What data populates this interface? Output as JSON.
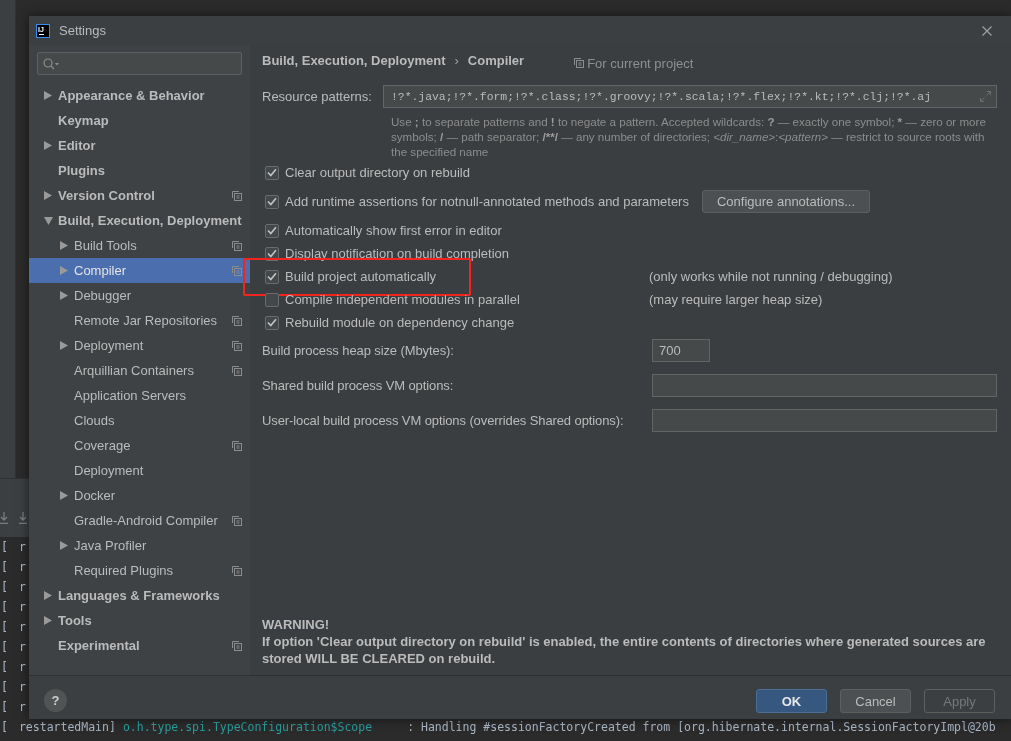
{
  "background": {
    "console": {
      "lines": [
        {
          "bracket": "[",
          "thread": "r"
        },
        {
          "bracket": "[",
          "thread": "r"
        },
        {
          "bracket": "[",
          "thread": "r"
        },
        {
          "bracket": "[",
          "thread": "r"
        },
        {
          "bracket": "[",
          "thread": "r"
        },
        {
          "bracket": "[",
          "thread": "r"
        },
        {
          "bracket": "[",
          "thread": "r"
        },
        {
          "bracket": "[",
          "thread": "r"
        },
        {
          "bracket": "[",
          "thread": "r"
        },
        {
          "bracket": "[",
          "thread": "restartedMain]",
          "logger": "o.h.type.spi.TypeConfiguration$Scope",
          "message": ": Handling #sessionFactoryCreated from [org.hibernate.internal.SessionFactoryImpl@20b"
        }
      ]
    }
  },
  "window": {
    "logo": "IJ",
    "title": "Settings"
  },
  "sidebar": {
    "items": [
      {
        "label": "Appearance & Behavior",
        "expanded": false,
        "project_level": false,
        "selected": false
      },
      {
        "label": "Keymap",
        "project_level": false,
        "selected": false
      },
      {
        "label": "Editor",
        "expanded": false,
        "project_level": false,
        "selected": false
      },
      {
        "label": "Plugins",
        "project_level": false,
        "selected": false
      },
      {
        "label": "Version Control",
        "expanded": false,
        "project_level": true,
        "selected": false
      },
      {
        "label": "Build, Execution, Deployment",
        "expanded": true,
        "project_level": false,
        "selected": false,
        "children": [
          {
            "label": "Build Tools",
            "expanded": false,
            "project_level": true,
            "selected": false
          },
          {
            "label": "Compiler",
            "expanded": false,
            "project_level": true,
            "selected": true
          },
          {
            "label": "Debugger",
            "expanded": false,
            "project_level": false,
            "selected": false
          },
          {
            "label": "Remote Jar Repositories",
            "project_level": true,
            "selected": false
          },
          {
            "label": "Deployment",
            "expanded": false,
            "project_level": true,
            "selected": false
          },
          {
            "label": "Arquillian Containers",
            "project_level": true,
            "selected": false
          },
          {
            "label": "Application Servers",
            "project_level": false,
            "selected": false
          },
          {
            "label": "Clouds",
            "project_level": false,
            "selected": false
          },
          {
            "label": "Coverage",
            "project_level": true,
            "selected": false
          },
          {
            "label": "Deployment",
            "project_level": false,
            "selected": false
          },
          {
            "label": "Docker",
            "expanded": false,
            "project_level": false,
            "selected": false
          },
          {
            "label": "Gradle-Android Compiler",
            "project_level": true,
            "selected": false
          },
          {
            "label": "Java Profiler",
            "expanded": false,
            "project_level": false,
            "selected": false
          },
          {
            "label": "Required Plugins",
            "project_level": true,
            "selected": false
          }
        ]
      },
      {
        "label": "Languages & Frameworks",
        "expanded": false,
        "project_level": false,
        "selected": false
      },
      {
        "label": "Tools",
        "expanded": false,
        "project_level": false,
        "selected": false
      },
      {
        "label": "Experimental",
        "project_level": true,
        "selected": false
      }
    ]
  },
  "breadcrumb": {
    "items": [
      "Build, Execution, Deployment",
      "Compiler"
    ],
    "separator": "›"
  },
  "scope_note": "For current project",
  "resource_patterns": {
    "label": "Resource patterns:",
    "value": "!?*.java;!?*.form;!?*.class;!?*.groovy;!?*.scala;!?*.flex;!?*.kt;!?*.clj;!?*.aj"
  },
  "help_text": [
    {
      "text": "Use ",
      "kind": "plain"
    },
    {
      "text": ";",
      "kind": "bold"
    },
    {
      "text": " to separate patterns and ",
      "kind": "plain"
    },
    {
      "text": "!",
      "kind": "bold"
    },
    {
      "text": " to negate a pattern. Accepted wildcards: ",
      "kind": "plain"
    },
    {
      "text": "?",
      "kind": "bold"
    },
    {
      "text": " — exactly one symbol; ",
      "kind": "plain"
    },
    {
      "text": "*",
      "kind": "bold"
    },
    {
      "text": " — zero or more symbols; ",
      "kind": "plain"
    },
    {
      "text": "/",
      "kind": "bold"
    },
    {
      "text": " — path separator; ",
      "kind": "plain"
    },
    {
      "text": "/**/",
      "kind": "bold"
    },
    {
      "text": " — any number of directories; ",
      "kind": "plain"
    },
    {
      "text": "<dir_name>",
      "kind": "italic"
    },
    {
      "text": ":",
      "kind": "plain"
    },
    {
      "text": "<pattern>",
      "kind": "italic"
    },
    {
      "text": " — restrict to source roots with the specified name",
      "kind": "plain"
    }
  ],
  "options": [
    {
      "label": "Clear output directory on rebuild",
      "checked": true,
      "highlighted": false
    },
    {
      "label": "Add runtime assertions for notnull-annotated methods and parameters",
      "checked": true,
      "highlighted": false,
      "button": "Configure annotations..."
    },
    {
      "label": "Automatically show first error in editor",
      "checked": true,
      "highlighted": false
    },
    {
      "label": "Display notification on build completion",
      "checked": true,
      "highlighted": false
    },
    {
      "label": "Build project automatically",
      "checked": true,
      "highlighted": true,
      "note": "(only works while not running / debugging)"
    },
    {
      "label": "Compile independent modules in parallel",
      "checked": false,
      "highlighted": false,
      "note": "(may require larger heap size)"
    },
    {
      "label": "Rebuild module on dependency change",
      "checked": true,
      "highlighted": false
    }
  ],
  "fields": [
    {
      "label": "Build process heap size (Mbytes):",
      "kind": "number",
      "value": "700"
    },
    {
      "label": "Shared build process VM options:",
      "kind": "text"
    },
    {
      "label": "User-local build process VM options (overrides Shared options):",
      "kind": "text"
    }
  ],
  "warning": {
    "title": "WARNING!",
    "text": "If option 'Clear output directory on rebuild' is enabled, the entire contents of directories where generated sources are stored WILL BE CLEARED on rebuild."
  },
  "help_button": "?",
  "buttons": [
    {
      "label": "OK",
      "kind": "primary",
      "disabled": false
    },
    {
      "label": "Cancel",
      "kind": "secondary",
      "disabled": false
    },
    {
      "label": "Apply",
      "kind": "secondary",
      "disabled": true
    }
  ]
}
